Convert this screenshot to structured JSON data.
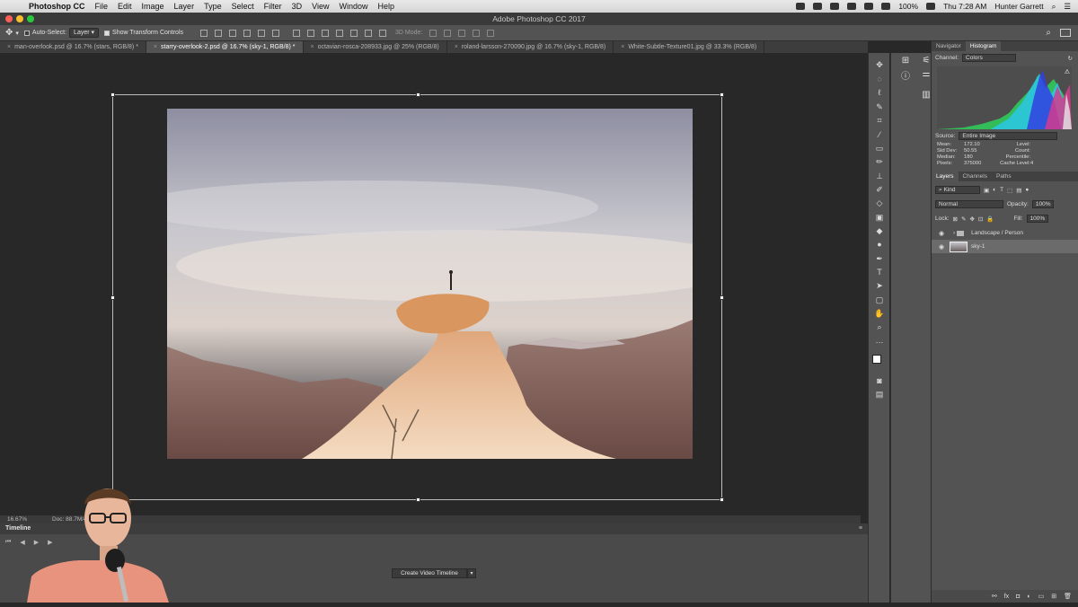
{
  "menubar": {
    "app_name": "Photoshop CC",
    "items": [
      "File",
      "Edit",
      "Image",
      "Layer",
      "Type",
      "Select",
      "Filter",
      "3D",
      "View",
      "Window",
      "Help"
    ],
    "battery": "100%",
    "clock": "Thu 7:28 AM",
    "user": "Hunter Garrett"
  },
  "window": {
    "title": "Adobe Photoshop CC 2017"
  },
  "options_bar": {
    "auto_select_label": "Auto-Select:",
    "auto_select_value": "Layer",
    "transform_controls_label": "Show Transform Controls",
    "mode_3d_label": "3D Mode:"
  },
  "doc_tabs": [
    {
      "label": "man-overlook.psd @ 16.7% (stars, RGB/8) *",
      "active": false
    },
    {
      "label": "starry-overlook-2.psd @ 16.7% (sky-1, RGB/8) *",
      "active": true
    },
    {
      "label": "octavian-rosca-208933.jpg @ 25% (RGB/8)",
      "active": false
    },
    {
      "label": "roland-larsson-270090.jpg @ 16.7% (sky-1, RGB/8)",
      "active": false
    },
    {
      "label": "White-Subtle-Texture01.jpg @ 33.3% (RGB/8)",
      "active": false
    }
  ],
  "status_bar": {
    "zoom": "16.67%",
    "doc_size": "Doc: 88.7M/45"
  },
  "timeline": {
    "title": "Timeline",
    "create_button": "Create Video Timeline",
    "dropdown_glyph": "▾"
  },
  "navigator_panel": {
    "tabs": [
      "Navigator",
      "Histogram"
    ],
    "active_tab": "Histogram",
    "channel_label": "Channel:",
    "channel_value": "Colors",
    "source_label": "Source:",
    "source_value": "Entire Image",
    "stats": {
      "mean_label": "Mean:",
      "mean": "172.10",
      "std_dev_label": "Std Dev:",
      "std_dev": "50.55",
      "median_label": "Median:",
      "median": "180",
      "pixels_label": "Pixels:",
      "pixels": "375000",
      "level_label": "Level:",
      "level": "",
      "count_label": "Count:",
      "count": "",
      "percentile_label": "Percentile:",
      "percentile": "",
      "cache_level_label": "Cache Level:",
      "cache_level": "4"
    }
  },
  "layers_panel": {
    "tabs": [
      "Layers",
      "Channels",
      "Paths"
    ],
    "active_tab": "Layers",
    "filter_label": "Kind",
    "blend_mode": "Normal",
    "opacity_label": "Opacity:",
    "opacity": "100%",
    "lock_label": "Lock:",
    "fill_label": "Fill:",
    "fill": "100%",
    "layers": [
      {
        "name": "Landscape / Person",
        "type": "group",
        "selected": false
      },
      {
        "name": "sky-1",
        "type": "layer",
        "selected": true
      }
    ]
  },
  "colors": {
    "app_bg": "#282828",
    "panel_bg": "#535353",
    "selected_layer": "#6b6b6b"
  }
}
